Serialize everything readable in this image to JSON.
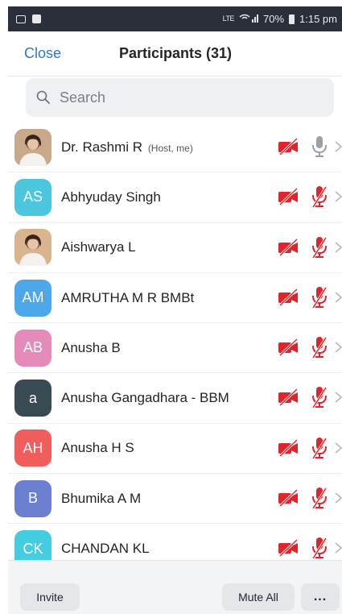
{
  "status_bar": {
    "network": "LTE",
    "battery": "70%",
    "time": "1:15 pm"
  },
  "header": {
    "close_label": "Close",
    "title": "Participants (31)"
  },
  "search": {
    "placeholder": "Search"
  },
  "participants": [
    {
      "name": "Dr. Rashmi R",
      "role": "(Host, me)",
      "avatar_type": "photo",
      "avatar_initials": "",
      "avatar_color": "#c9a98c",
      "video_off": true,
      "audio_muted": false
    },
    {
      "name": "Abhyuday Singh",
      "role": "",
      "avatar_type": "initials",
      "avatar_initials": "AS",
      "avatar_color": "#4cc6dc",
      "video_off": true,
      "audio_muted": true
    },
    {
      "name": "Aishwarya L",
      "role": "",
      "avatar_type": "photo",
      "avatar_initials": "",
      "avatar_color": "#d9b58f",
      "video_off": true,
      "audio_muted": true
    },
    {
      "name": "AMRUTHA M R BMBt",
      "role": "",
      "avatar_type": "initials",
      "avatar_initials": "AM",
      "avatar_color": "#4da8ea",
      "video_off": true,
      "audio_muted": true
    },
    {
      "name": "Anusha B",
      "role": "",
      "avatar_type": "initials",
      "avatar_initials": "AB",
      "avatar_color": "#e58bb9",
      "video_off": true,
      "audio_muted": true
    },
    {
      "name": "Anusha Gangadhara - BBM",
      "role": "",
      "avatar_type": "initials",
      "avatar_initials": "a",
      "avatar_color": "#3a4a52",
      "video_off": true,
      "audio_muted": true
    },
    {
      "name": "Anusha H S",
      "role": "",
      "avatar_type": "initials",
      "avatar_initials": "AH",
      "avatar_color": "#ef5e5c",
      "video_off": true,
      "audio_muted": true
    },
    {
      "name": "Bhumika  A M",
      "role": "",
      "avatar_type": "initials",
      "avatar_initials": "B",
      "avatar_color": "#6b7fd1",
      "video_off": true,
      "audio_muted": true
    },
    {
      "name": "CHANDAN KL",
      "role": "",
      "avatar_type": "initials",
      "avatar_initials": "CK",
      "avatar_color": "#44cde0",
      "video_off": true,
      "audio_muted": true
    }
  ],
  "footer": {
    "invite_label": "Invite",
    "mute_all_label": "Mute All",
    "more_label": "..."
  },
  "colors": {
    "accent": "#2f77c7",
    "muted_red": "#e0242c",
    "unmuted_grey": "#9aa0a6"
  },
  "icons": {
    "video_off": "video-off-icon",
    "mic_muted": "mic-muted-icon",
    "mic_on": "mic-icon",
    "chevron": "chevron-right-icon",
    "search": "search-icon"
  }
}
